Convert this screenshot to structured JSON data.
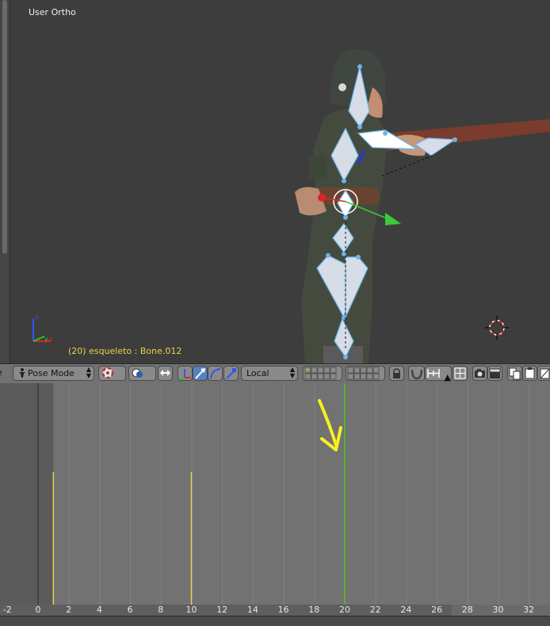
{
  "viewport": {
    "view_label": "User Ortho",
    "status_text": "(20) esqueleto : Bone.012"
  },
  "header": {
    "mode_label": "Pose Mode",
    "orientation_label": "Local"
  },
  "timeline": {
    "current_frame": 20,
    "keyframes": [
      1,
      10
    ],
    "frame_labels": [
      "-2",
      "0",
      "2",
      "4",
      "6",
      "8",
      "10",
      "12",
      "14",
      "16",
      "18",
      "20",
      "22",
      "24",
      "26",
      "28",
      "30",
      "32"
    ]
  },
  "colors": {
    "accent": "#5680c2",
    "playhead": "#55b02f",
    "keyframe": "#e6d24a",
    "annotation": "#f5f020",
    "bone": "#6ab4ea"
  }
}
